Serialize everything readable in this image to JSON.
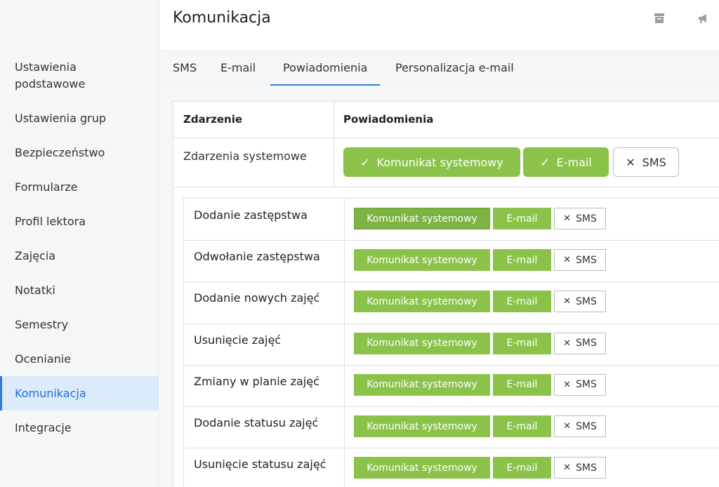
{
  "sidebar": {
    "items": [
      {
        "label": "Ustawienia\npodstawowe"
      },
      {
        "label": "Ustawienia grup"
      },
      {
        "label": "Bezpieczeństwo"
      },
      {
        "label": "Formularze"
      },
      {
        "label": "Profil lektora"
      },
      {
        "label": "Zajęcia"
      },
      {
        "label": "Notatki"
      },
      {
        "label": "Semestry"
      },
      {
        "label": "Ocenianie"
      },
      {
        "label": "Komunikacja"
      },
      {
        "label": "Integracje"
      }
    ],
    "active_index": 9
  },
  "header": {
    "title": "Komunikacja",
    "icons": [
      "archive-icon",
      "megaphone-icon"
    ]
  },
  "tabs": [
    {
      "label": "SMS"
    },
    {
      "label": "E-mail"
    },
    {
      "label": "Powiadomienia"
    },
    {
      "label": "Personalizacja e-mail"
    }
  ],
  "active_tab": 2,
  "table": {
    "col_event": "Zdarzenie",
    "col_notifications": "Powiadomienia",
    "system_row": {
      "label": "Zdarzenia systemowe",
      "btn_system": "Komunikat systemowy",
      "btn_email": "E-mail",
      "btn_sms": "SMS"
    },
    "events": [
      {
        "label": "Dodanie zastępstwa",
        "system": "Komunikat systemowy",
        "email": "E-mail",
        "sms": "SMS"
      },
      {
        "label": "Odwołanie zastępstwa",
        "system": "Komunikat systemowy",
        "email": "E-mail",
        "sms": "SMS"
      },
      {
        "label": "Dodanie nowych zajęć",
        "system": "Komunikat systemowy",
        "email": "E-mail",
        "sms": "SMS"
      },
      {
        "label": "Usunięcie zajęć",
        "system": "Komunikat systemowy",
        "email": "E-mail",
        "sms": "SMS"
      },
      {
        "label": "Zmiany w planie zajęć",
        "system": "Komunikat systemowy",
        "email": "E-mail",
        "sms": "SMS"
      },
      {
        "label": "Dodanie statusu zajęć",
        "system": "Komunikat systemowy",
        "email": "E-mail",
        "sms": "SMS"
      },
      {
        "label": "Usunięcie statusu zajęć",
        "system": "Komunikat systemowy",
        "email": "E-mail",
        "sms": "SMS"
      }
    ]
  },
  "colors": {
    "accent_green": "#8bc34a",
    "accent_blue": "#2f7bdc",
    "active_bg": "#dcebfc"
  }
}
